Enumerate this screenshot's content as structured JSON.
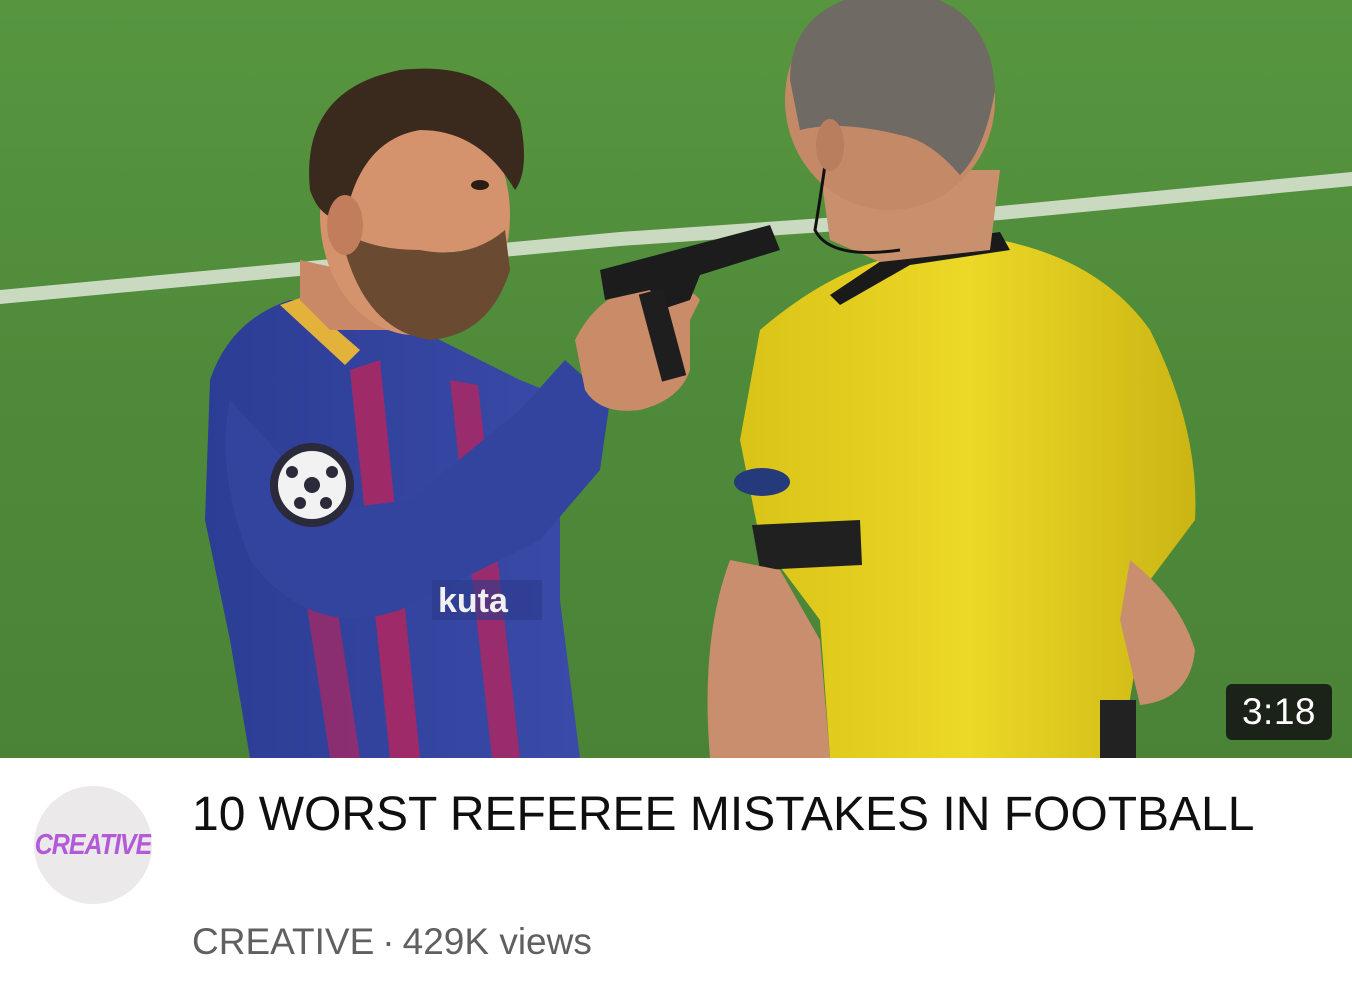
{
  "video": {
    "duration": "3:18",
    "title": "10 WORST REFEREE MISTAKES IN FOOTBALL",
    "views": "429K views"
  },
  "channel": {
    "name": "CREATIVE",
    "avatar_text": "CREATIVE"
  },
  "separator": "·",
  "thumbnail": {
    "description_icon": "video-thumbnail-image",
    "jersey_text": "kuta"
  },
  "colors": {
    "pitch": "#4f8a3a",
    "referee_shirt": "#e7d21f",
    "player_shirt": "#2f3f9a",
    "player_stripe": "#b2265f",
    "avatar_text": "#b35ad9",
    "title_text": "#0f0f0f",
    "meta_text": "#606060"
  }
}
